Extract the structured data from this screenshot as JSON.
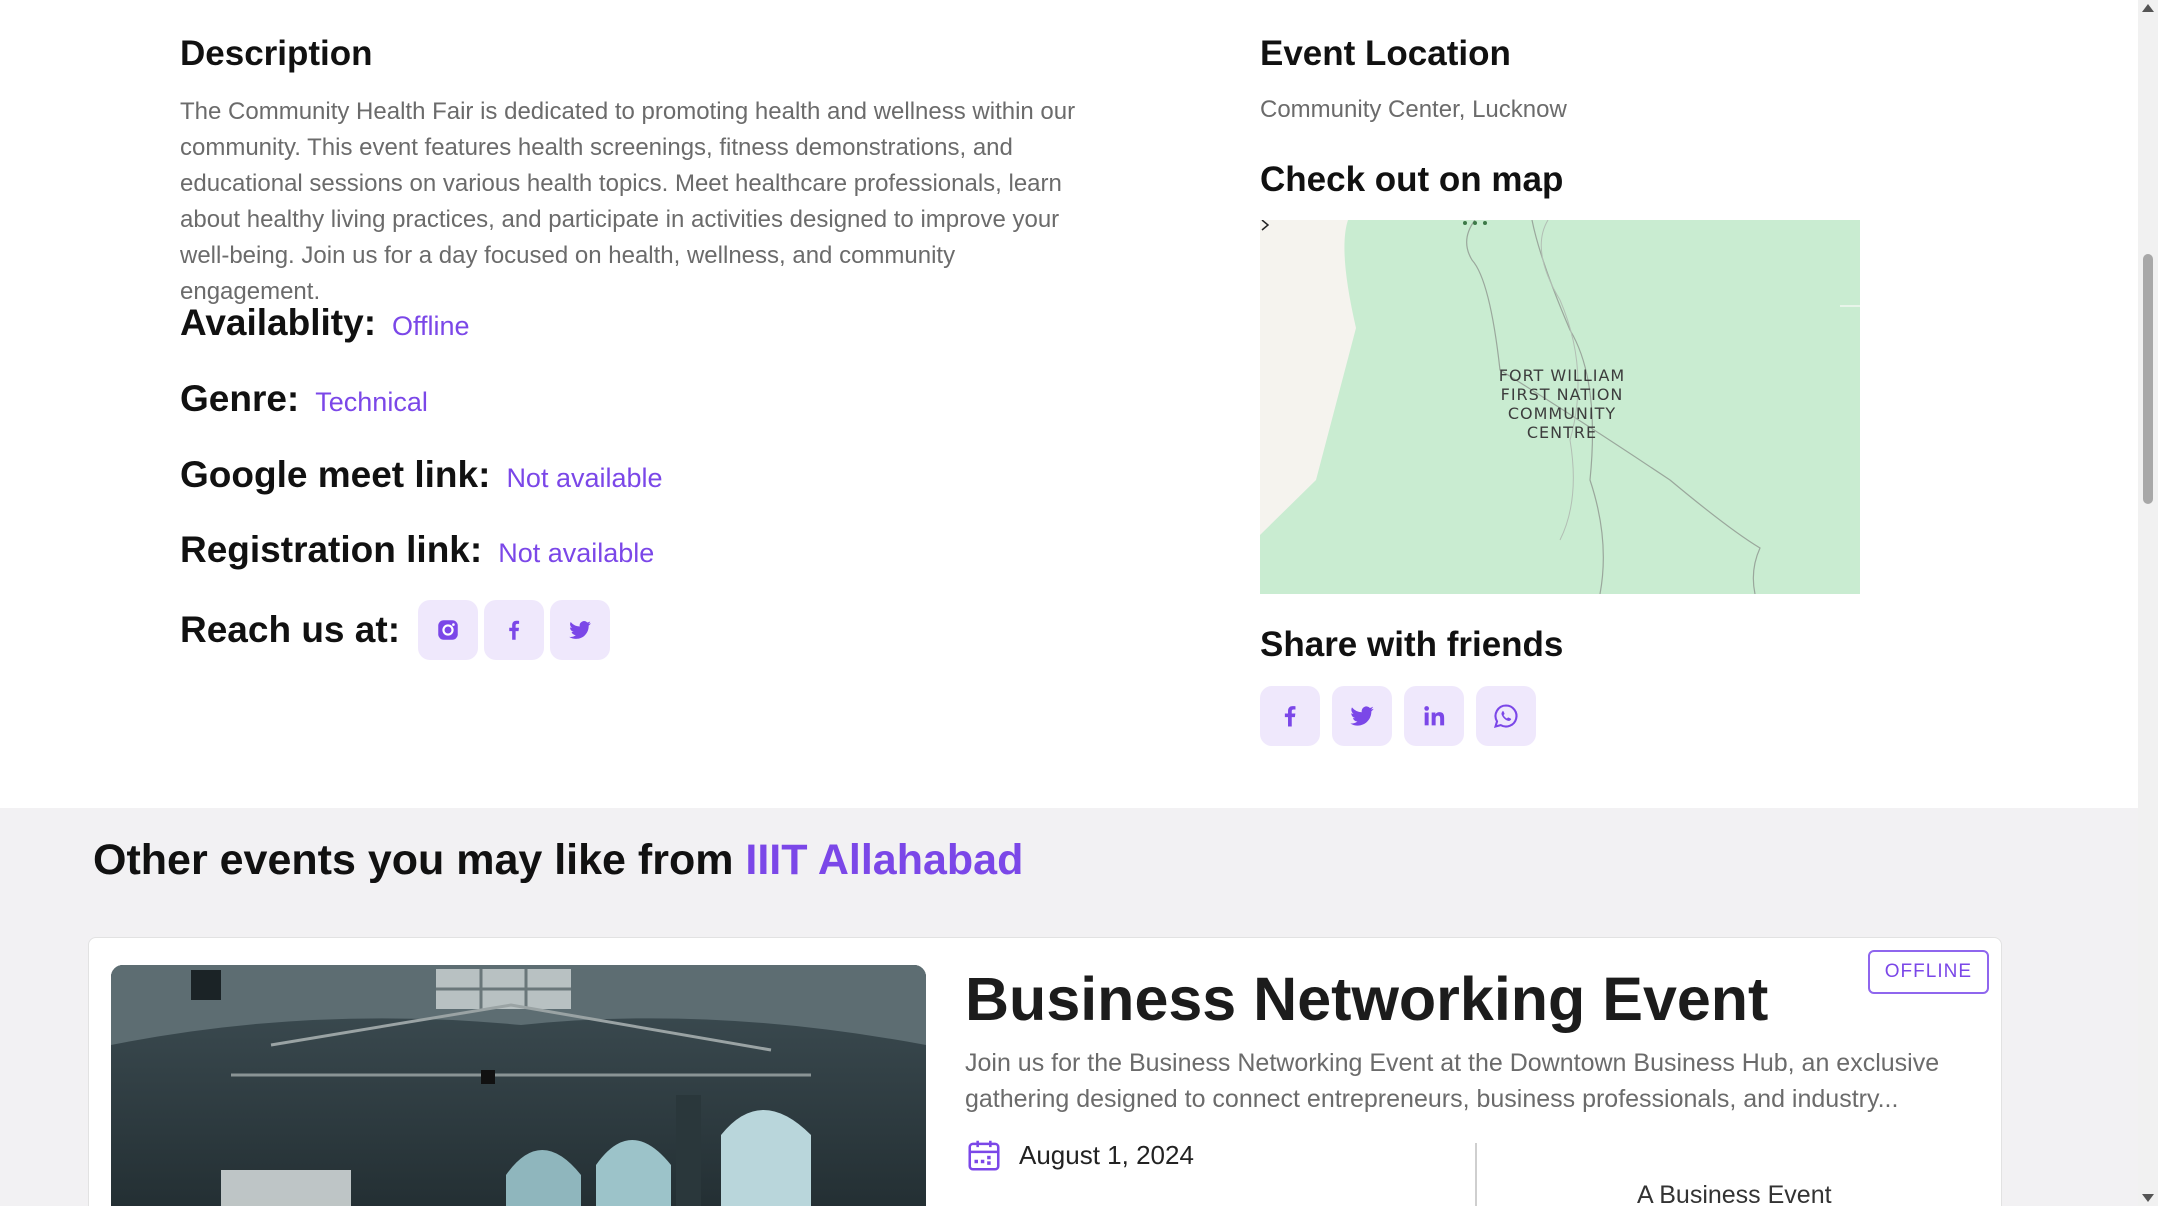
{
  "description": {
    "heading": "Description",
    "text": "The Community Health Fair is dedicated to promoting health and wellness within our community. This event features health screenings, fitness demonstrations, and educational sessions on various health topics. Meet healthcare professionals, learn about healthy living practices, and participate in activities designed to improve your well-being. Join us for a day focused on health, wellness, and community engagement."
  },
  "fields": {
    "availability": {
      "label": "Availablity:",
      "value": "Offline"
    },
    "genre": {
      "label": "Genre:",
      "value": "Technical"
    },
    "meet": {
      "label": "Google meet link:",
      "value": "Not available"
    },
    "registration": {
      "label": "Registration link:",
      "value": "Not available"
    }
  },
  "reach": {
    "label": "Reach us at:",
    "icons": [
      "instagram-icon",
      "facebook-icon",
      "twitter-icon"
    ]
  },
  "location": {
    "heading": "Event Location",
    "text": "Community Center, Lucknow"
  },
  "map": {
    "heading": "Check out on map",
    "label_lines": [
      "FORT WILLIAM",
      "FIRST NATION",
      "COMMUNITY",
      "CENTRE"
    ]
  },
  "share": {
    "heading": "Share with friends",
    "icons": [
      "facebook-icon",
      "twitter-icon",
      "linkedin-icon",
      "whatsapp-icon"
    ]
  },
  "other_events": {
    "heading_prefix": "Other events you may like from",
    "heading_org": "IIIT Allahabad",
    "card": {
      "title": "Business Networking Event",
      "description": "Join us for the Business Networking Event at the Downtown Business Hub, an exclusive gathering designed to connect entrepreneurs, business professionals, and industry...",
      "date": "August 1, 2024",
      "subtitle": "A Business Event",
      "badge": "OFFLINE"
    }
  },
  "colors": {
    "accent": "#7b47e8",
    "icon_bg": "#efe8fc",
    "map_green": "#c9ecd1",
    "band_bg": "#f2f1f3"
  }
}
